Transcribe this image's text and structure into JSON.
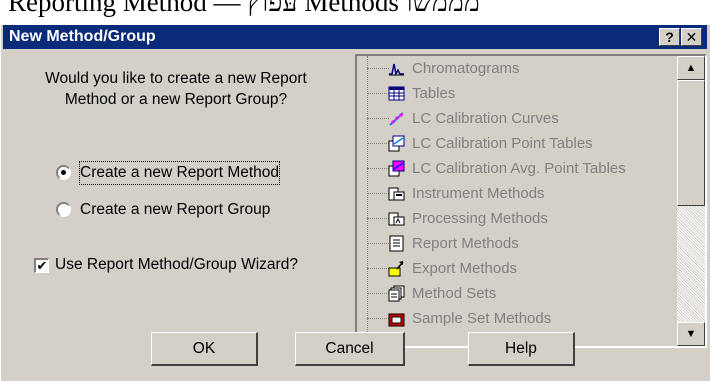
{
  "background_caption": "Reporting Method — עּפוץ Methods מממשו",
  "dialog": {
    "title": "New Method/Group",
    "help_button": "?",
    "close_button": "✕",
    "question": "Would you like to create a new Report Method or a new Report Group?",
    "options": [
      {
        "label": "Create a new Report Method",
        "selected": true
      },
      {
        "label": "Create a new Report Group",
        "selected": false
      }
    ],
    "wizard_checkbox": {
      "label": "Use Report Method/Group Wizard?",
      "checked": true,
      "mark": "✔"
    },
    "tree_items": [
      {
        "label": "Chromatograms",
        "icon": "chromatogram-icon"
      },
      {
        "label": "Tables",
        "icon": "table-icon"
      },
      {
        "label": "LC Calibration Curves",
        "icon": "calibration-curve-icon"
      },
      {
        "label": "LC Calibration Point Tables",
        "icon": "calibration-point-table-icon"
      },
      {
        "label": "LC Calibration Avg. Point Tables",
        "icon": "calibration-avg-table-icon"
      },
      {
        "label": "Instrument Methods",
        "icon": "instrument-method-icon"
      },
      {
        "label": "Processing Methods",
        "icon": "processing-method-icon"
      },
      {
        "label": "Report Methods",
        "icon": "report-method-icon"
      },
      {
        "label": "Export Methods",
        "icon": "export-method-icon"
      },
      {
        "label": "Method Sets",
        "icon": "method-set-icon"
      },
      {
        "label": "Sample Set Methods",
        "icon": "sample-set-method-icon"
      }
    ],
    "scroll_up": "▲",
    "scroll_down": "▼",
    "buttons": {
      "ok": "OK",
      "cancel": "Cancel",
      "help": "Help"
    }
  }
}
